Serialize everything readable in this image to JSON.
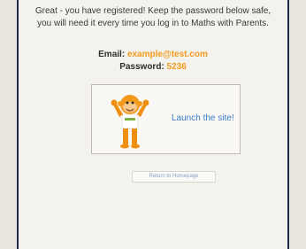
{
  "message": {
    "line1": "Great - you have registered! Keep the password below safe,",
    "line2": "you will need it every time you log in to Maths with Parents."
  },
  "credentials": {
    "email_label": "Email:",
    "email_value": "example@test.com",
    "password_label": "Password:",
    "password_value": "5236"
  },
  "launch": {
    "label": "Launch the site!",
    "mascot_icon": "monkey-mascot-icon"
  },
  "return_button": {
    "label": "Return to Homepage"
  },
  "colors": {
    "accent_orange": "#f29a1c",
    "link_blue": "#3b7cc4",
    "frame_border": "#1f2a44"
  }
}
